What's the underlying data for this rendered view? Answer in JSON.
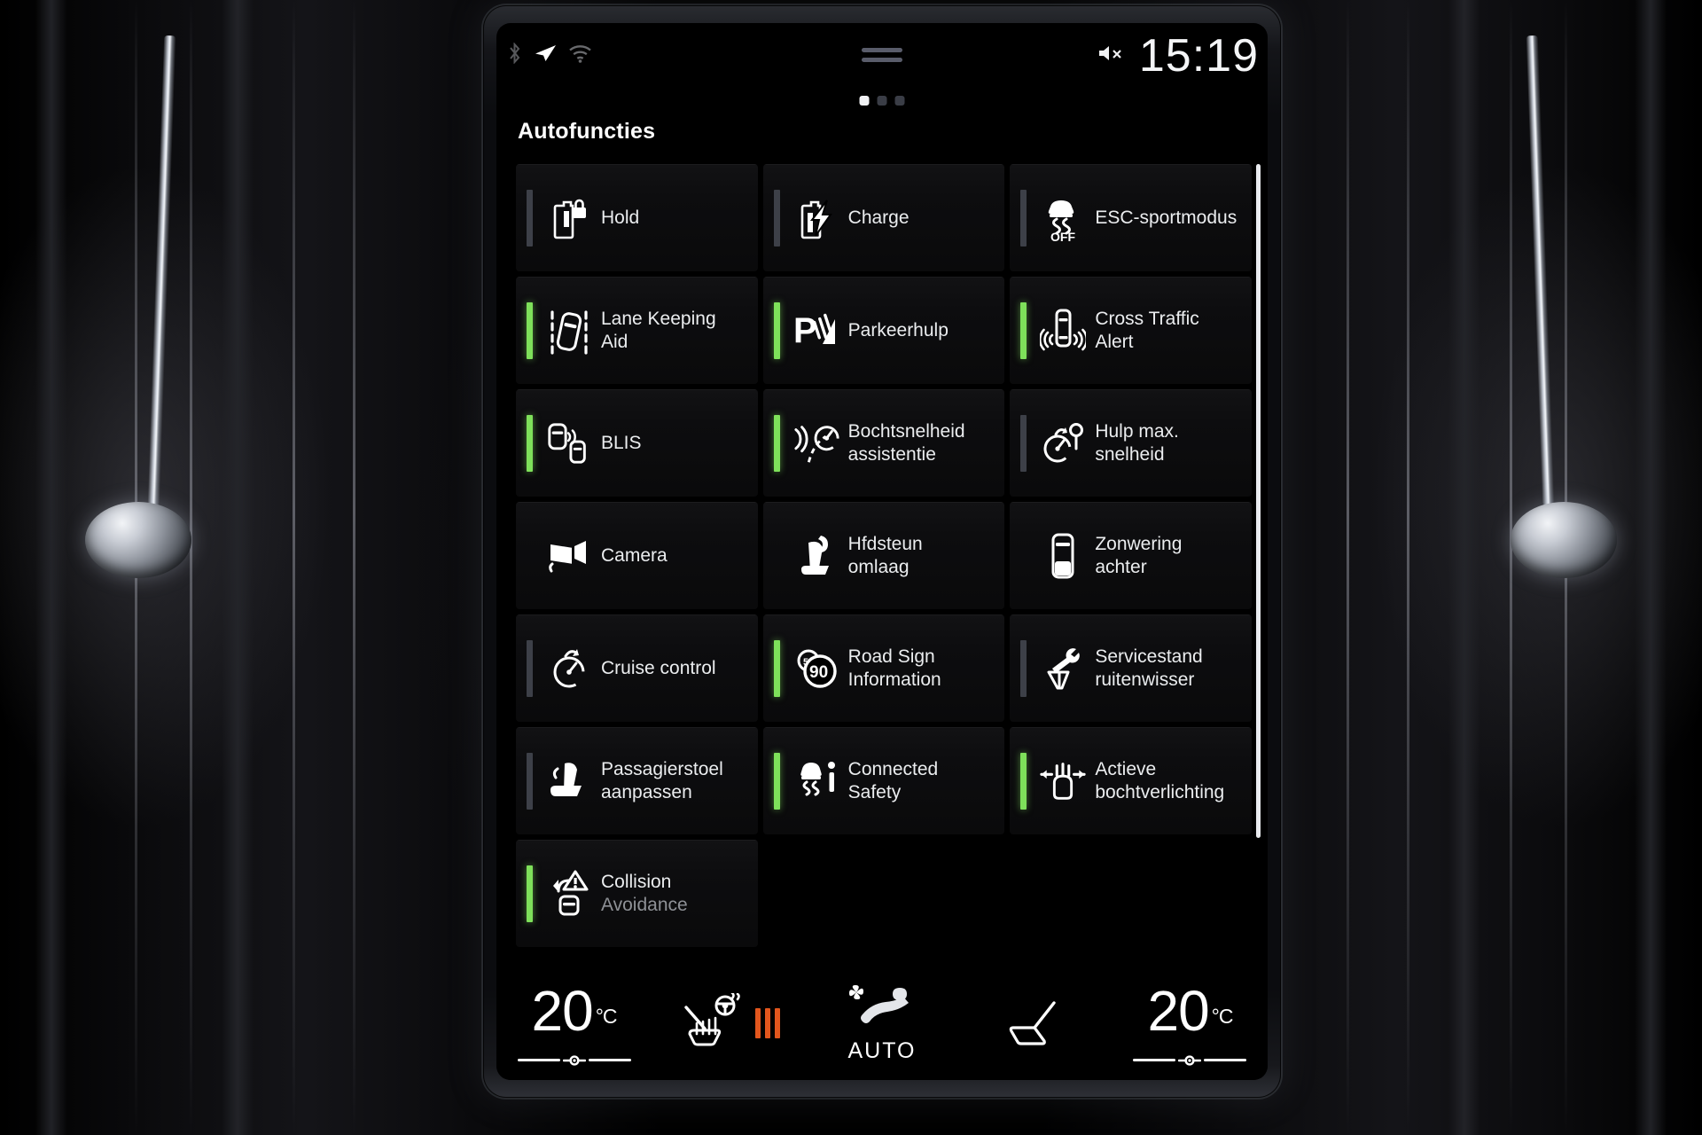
{
  "status_bar": {
    "icons_left": [
      "bluetooth-icon",
      "navigation-arrow-icon",
      "wifi-icon"
    ],
    "mute_icon": "mute-icon",
    "clock": "15:19",
    "page_dots": {
      "count": 3,
      "active_index": 0
    }
  },
  "page_title": "Autofuncties",
  "tiles": [
    {
      "label_line1": "Hold",
      "label_line2": "",
      "icon": "battery-lock-icon",
      "indicator": "off"
    },
    {
      "label_line1": "Charge",
      "label_line2": "",
      "icon": "battery-charge-icon",
      "indicator": "off"
    },
    {
      "label_line1": "ESC-sportmodus",
      "label_line2": "",
      "icon": "esc-off-icon",
      "indicator": "off"
    },
    {
      "label_line1": "Lane Keeping",
      "label_line2": "Aid",
      "icon": "lane-keeping-icon",
      "indicator": "on"
    },
    {
      "label_line1": "Parkeerhulp",
      "label_line2": "",
      "icon": "park-assist-icon",
      "indicator": "on"
    },
    {
      "label_line1": "Cross Traffic",
      "label_line2": "Alert",
      "icon": "cross-traffic-icon",
      "indicator": "on"
    },
    {
      "label_line1": "BLIS",
      "label_line2": "",
      "icon": "blind-spot-icon",
      "indicator": "on"
    },
    {
      "label_line1": "Bochtsnelheid",
      "label_line2": "assistentie",
      "icon": "curve-speed-icon",
      "indicator": "on"
    },
    {
      "label_line1": "Hulp max.",
      "label_line2": "snelheid",
      "icon": "max-speed-assist-icon",
      "indicator": "off"
    },
    {
      "label_line1": "Camera",
      "label_line2": "",
      "icon": "camera-icon",
      "indicator": "none"
    },
    {
      "label_line1": "Hfdsteun",
      "label_line2": "omlaag",
      "icon": "headrest-down-icon",
      "indicator": "none"
    },
    {
      "label_line1": "Zonwering",
      "label_line2": "achter",
      "icon": "rear-sunblind-icon",
      "indicator": "none"
    },
    {
      "label_line1": "Cruise control",
      "label_line2": "",
      "icon": "cruise-control-icon",
      "indicator": "off"
    },
    {
      "label_line1": "Road Sign",
      "label_line2": "Information",
      "icon": "road-sign-90-icon",
      "indicator": "on"
    },
    {
      "label_line1": "Servicestand",
      "label_line2": "ruitenwisser",
      "icon": "wiper-service-icon",
      "indicator": "off"
    },
    {
      "label_line1": "Passagierstoel",
      "label_line2": "aanpassen",
      "icon": "passenger-seat-icon",
      "indicator": "off"
    },
    {
      "label_line1": "Connected",
      "label_line2": "Safety",
      "icon": "connected-safety-icon",
      "indicator": "on"
    },
    {
      "label_line1": "Actieve",
      "label_line2": "bochtverlichting",
      "icon": "active-bending-light-icon",
      "indicator": "on"
    },
    {
      "label_line1": "Collision",
      "label_line2": "Avoidance",
      "icon": "collision-avoidance-icon",
      "indicator": "on",
      "label_line2_dim": true
    }
  ],
  "climate": {
    "left_temp": "20",
    "left_unit": "°C",
    "right_temp": "20",
    "right_unit": "°C",
    "heated_seat_icon": "heated-seat-steering-icon",
    "heat_level_bars": 3,
    "fan_icon": "fan-airflow-seat-icon",
    "fan_mode": "AUTO",
    "right_seat_icon": "seat-icon"
  },
  "colors": {
    "indicator_on": "#7ee05a",
    "indicator_off": "#3d4048",
    "heat_orange": "#e2561d",
    "text_primary": "#ebedef",
    "text_dim": "#8e9196"
  }
}
